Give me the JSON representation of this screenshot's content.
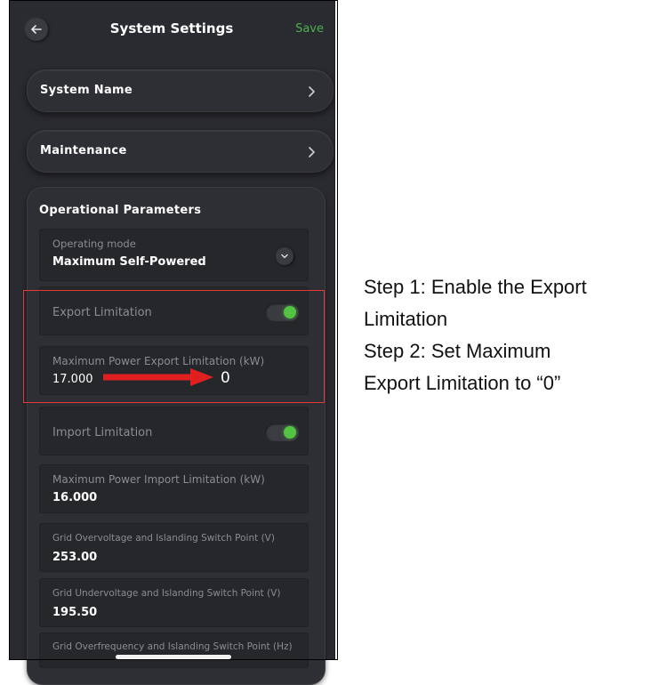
{
  "header": {
    "title": "System Settings",
    "save_label": "Save",
    "back_icon": "arrow-left-icon"
  },
  "menu": {
    "system_name": "System Name",
    "maintenance": "Maintenance"
  },
  "operational": {
    "title": "Operational Parameters",
    "operating_mode": {
      "label": "Operating mode",
      "value": "Maximum Self-Powered"
    },
    "export_limitation": {
      "label": "Export Limitation",
      "enabled": true
    },
    "max_export": {
      "label": "Maximum Power Export Limitation (kW)",
      "value": "17.000",
      "new_value": "0"
    },
    "import_limitation": {
      "label": "Import Limitation",
      "enabled": true
    },
    "max_import": {
      "label": "Maximum Power Import Limitation (kW)",
      "value": "16.000"
    },
    "grid_overvoltage": {
      "label": "Grid Overvoltage and Islanding Switch Point (V)",
      "value": "253.00"
    },
    "grid_undervoltage": {
      "label": "Grid Undervoltage and Islanding Switch Point (V)",
      "value": "195.50"
    },
    "grid_overfrequency": {
      "label": "Grid Overfrequency and Islanding Switch Point (Hz)"
    }
  },
  "instructions": {
    "line1": "Step 1: Enable the Export",
    "line2": "Limitation",
    "line3": "Step 2: Set Maximum",
    "line4": "Export Limitation to “0”"
  },
  "colors": {
    "accent_green": "#4caf50",
    "toggle_on": "#52c441",
    "highlight_red": "#e53935",
    "background_dark": "#2a2b30"
  }
}
